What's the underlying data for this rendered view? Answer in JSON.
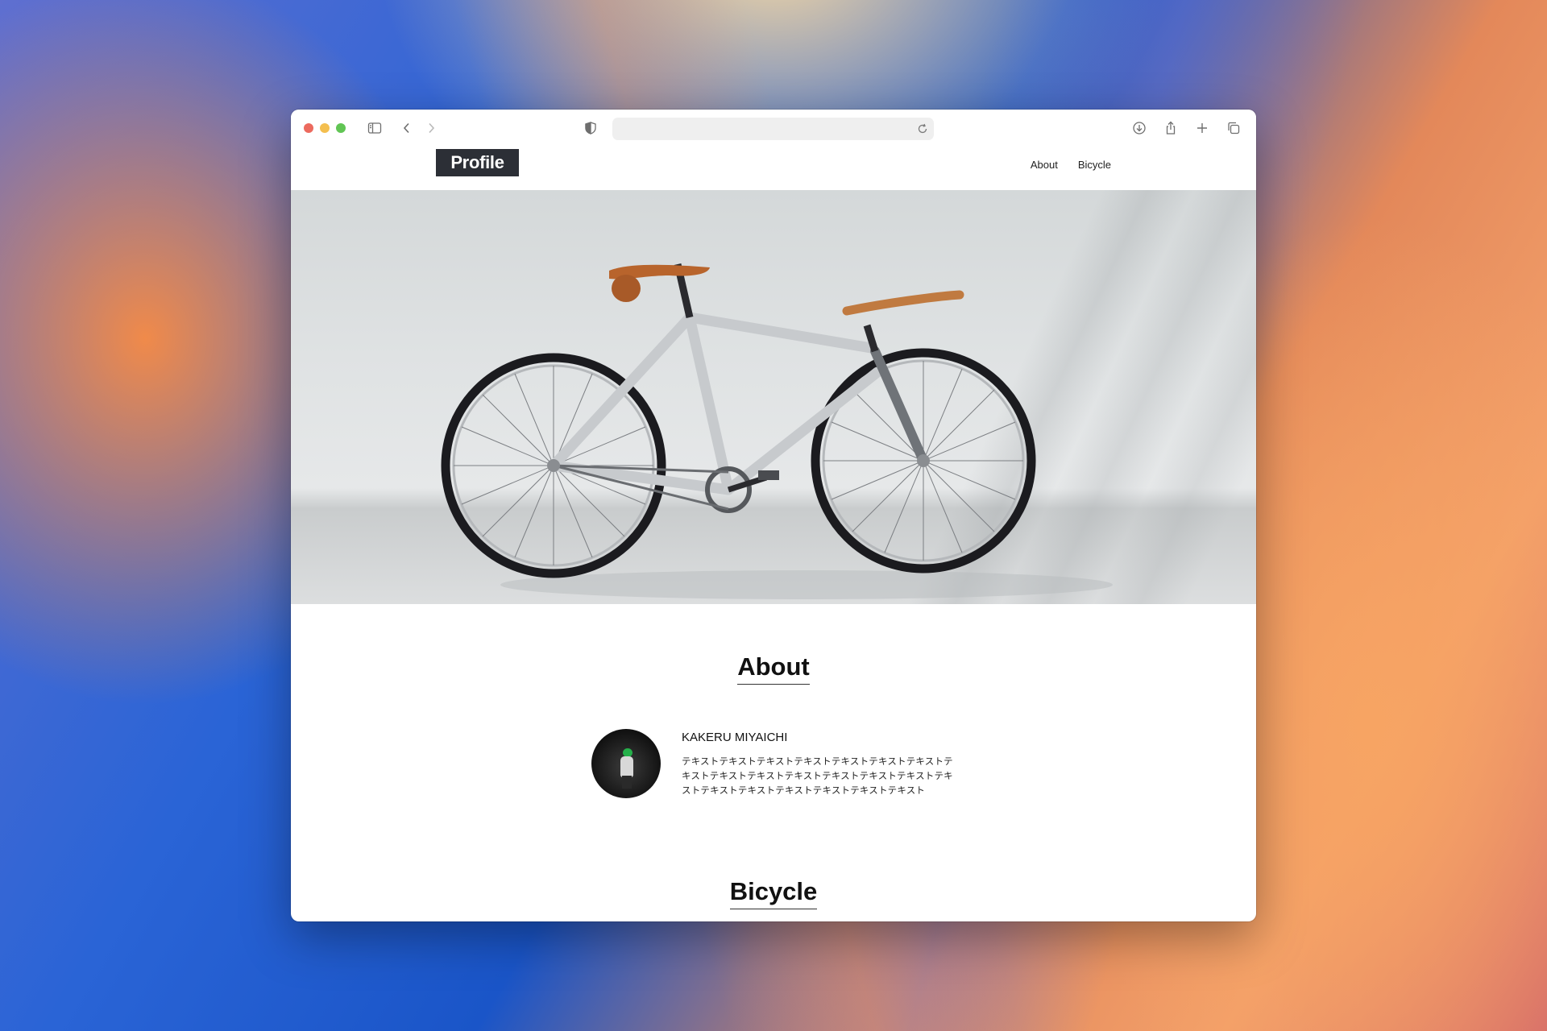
{
  "browser": {
    "address_value": "",
    "icons": [
      "sidebar-icon",
      "back-icon",
      "forward-icon",
      "shield-icon",
      "reload-icon",
      "download-icon",
      "share-icon",
      "new-tab-icon",
      "tabs-overview-icon"
    ]
  },
  "site": {
    "logo": "Profile",
    "nav": [
      {
        "label": "About"
      },
      {
        "label": "Bicycle"
      }
    ]
  },
  "hero": {
    "image_subject": "bicycle"
  },
  "about": {
    "title": "About",
    "name": "KAKERU MIYAICHI",
    "bio": "テキストテキストテキストテキストテキストテキストテキストテキストテキストテキストテキストテキストテキストテキストテキストテキストテキストテキストテキストテキストテキスト"
  },
  "bicycle": {
    "title": "Bicycle"
  },
  "colors": {
    "logo_bg": "#2c2f36",
    "traffic_close": "#ec6a5e",
    "traffic_min": "#f4bf4f",
    "traffic_max": "#61c554"
  }
}
